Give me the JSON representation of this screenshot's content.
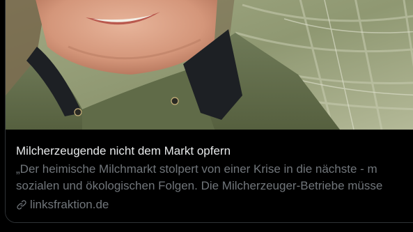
{
  "link_card": {
    "title": "Milcherzeugende nicht dem Markt opfern",
    "description_line_1": "„Der heimische Milchmarkt stolpert von einer Krise in die nächste - m",
    "description_line_2": "sozialen und ökologischen Folgen. Die Milcherzeuger-Betriebe müsse",
    "domain": "linksfraktion.de",
    "domain_icon": "link-icon"
  },
  "colors": {
    "background": "#000000",
    "title_text": "#e7e9ea",
    "secondary_text": "#71767b",
    "card_border": "#2f3336"
  }
}
